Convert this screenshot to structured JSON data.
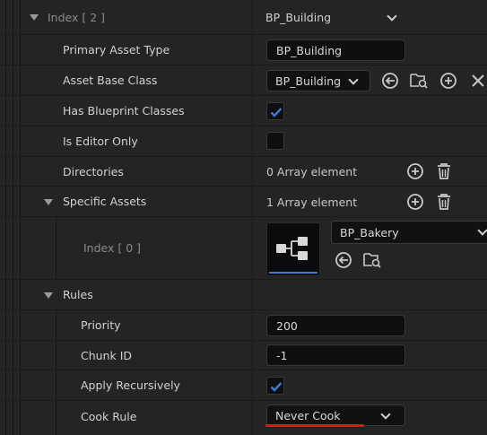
{
  "colors": {
    "accent_blue": "#3d7bd6",
    "annotation_red": "#e0161b",
    "panel_bg": "#242424",
    "field_bg": "#0f0f0f"
  },
  "index_row": {
    "label": "Index [ 2 ]",
    "value": "BP_Building"
  },
  "primary_asset_type": {
    "label": "Primary Asset Type",
    "value": "BP_Building"
  },
  "asset_base_class": {
    "label": "Asset Base Class",
    "value": "BP_Building",
    "icons": [
      "browse-back-icon",
      "find-in-browser-icon",
      "add-icon",
      "clear-icon"
    ]
  },
  "has_blueprint_classes": {
    "label": "Has Blueprint Classes",
    "checked": true
  },
  "is_editor_only": {
    "label": "Is Editor Only",
    "checked": false
  },
  "directories": {
    "label": "Directories",
    "value": "0 Array element"
  },
  "specific_assets": {
    "label": "Specific Assets",
    "value": "1 Array element"
  },
  "specific_asset_index": {
    "label": "Index [ 0 ]",
    "value": "BP_Bakery"
  },
  "rules": {
    "label": "Rules"
  },
  "priority": {
    "label": "Priority",
    "value": "200"
  },
  "chunk_id": {
    "label": "Chunk ID",
    "value": "-1"
  },
  "apply_recursively": {
    "label": "Apply Recursively",
    "checked": true
  },
  "cook_rule": {
    "label": "Cook Rule",
    "value": "Never Cook"
  }
}
